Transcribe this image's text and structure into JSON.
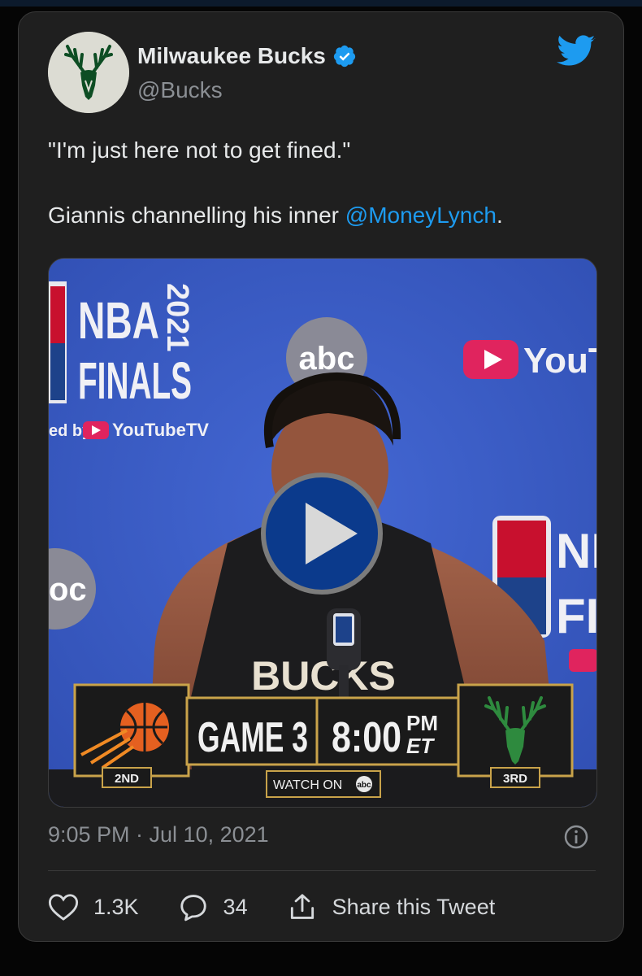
{
  "tweet": {
    "author_name": "Milwaukee Bucks",
    "handle": "@Bucks",
    "verified": true,
    "text_line1": "\"I'm just here not to get fined.\"",
    "text_line2_prefix": "Giannis channelling his inner ",
    "mention": "@MoneyLynch",
    "text_line2_suffix": ".",
    "timestamp": "9:05 PM · Jul 10, 2021"
  },
  "media": {
    "type": "video",
    "backdrop_nba": "NBA",
    "backdrop_finals": "FINALS",
    "backdrop_year": "2021",
    "backdrop_sponsor_prefix": "ed by",
    "backdrop_sponsor": "YouTubeTV",
    "backdrop_abc": "abc",
    "backdrop_youtube": "YouTu",
    "backdrop_right_nba": "NI",
    "backdrop_right_finals": "FI",
    "backdrop_left_abc": "oc",
    "jersey_text": "BUCKS",
    "scoreboard": {
      "game_label": "GAME 3",
      "time": "8:00",
      "time_suffix_top": "PM",
      "time_suffix_bottom": "ET",
      "left_team_seed": "2ND",
      "right_team_seed": "3RD",
      "watch_on": "WATCH ON",
      "network": "abc"
    }
  },
  "actions": {
    "likes": "1.3K",
    "replies": "34",
    "share": "Share this Tweet"
  },
  "colors": {
    "background": "#1f1f1f",
    "accent": "#1d9bf0",
    "backdrop_blue": "#3b5ec8",
    "bucks_green": "#0d4d23"
  }
}
